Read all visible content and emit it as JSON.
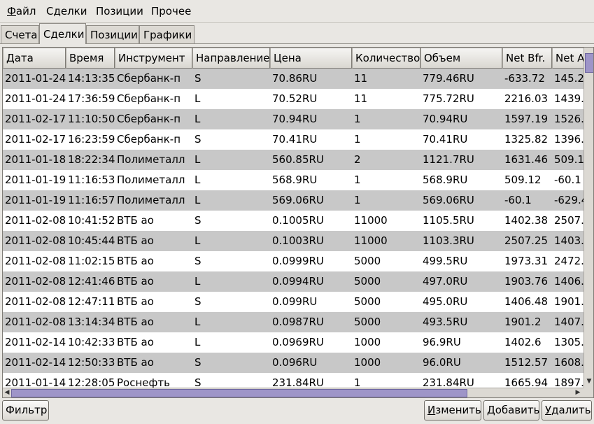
{
  "menubar": {
    "items": [
      {
        "label": "Файл",
        "underline": "Ф",
        "rest": "айл"
      },
      {
        "label": "Сделки"
      },
      {
        "label": "Позиции"
      },
      {
        "label": "Прочее"
      }
    ]
  },
  "tabs": [
    {
      "label": "Счета",
      "active": false
    },
    {
      "label": "Сделки",
      "active": true
    },
    {
      "label": "Позиции",
      "active": false
    },
    {
      "label": "Графики",
      "active": false
    }
  ],
  "table": {
    "columns": [
      "Дата",
      "Время",
      "Инструмент",
      "Направление",
      "Цена",
      "Количество",
      "Объем",
      "Net Bfr.",
      "Net A"
    ],
    "rows": [
      [
        "2011-01-24",
        "14:13:35",
        "Сбербанк-п",
        "S",
        "70.86RU",
        "11",
        "779.46RU",
        "-633.72",
        "145.2"
      ],
      [
        "2011-01-24",
        "17:36:59",
        "Сбербанк-п",
        "L",
        "70.52RU",
        "11",
        "775.72RU",
        "2216.03",
        "1439."
      ],
      [
        "2011-02-17",
        "11:10:50",
        "Сбербанк-п",
        "L",
        "70.94RU",
        "1",
        "70.94RU",
        "1597.19",
        "1526."
      ],
      [
        "2011-02-17",
        "16:23:59",
        "Сбербанк-п",
        "S",
        "70.41RU",
        "1",
        "70.41RU",
        "1325.82",
        "1396."
      ],
      [
        "2011-01-18",
        "18:22:34",
        "Полиметалл",
        "L",
        "560.85RU",
        "2",
        "1121.7RU",
        "1631.46",
        "509.1"
      ],
      [
        "2011-01-19",
        "11:16:53",
        "Полиметалл",
        "L",
        "568.9RU",
        "1",
        "568.9RU",
        "509.12",
        "-60.1"
      ],
      [
        "2011-01-19",
        "11:16:57",
        "Полиметалл",
        "L",
        "569.06RU",
        "1",
        "569.06RU",
        "-60.1",
        "-629.4"
      ],
      [
        "2011-02-08",
        "10:41:52",
        "ВТБ ао",
        "S",
        "0.1005RU",
        "11000",
        "1105.5RU",
        "1402.38",
        "2507."
      ],
      [
        "2011-02-08",
        "10:45:44",
        "ВТБ ао",
        "L",
        "0.1003RU",
        "11000",
        "1103.3RU",
        "2507.25",
        "1403."
      ],
      [
        "2011-02-08",
        "11:02:15",
        "ВТБ ао",
        "S",
        "0.0999RU",
        "5000",
        "499.5RU",
        "1973.31",
        "2472."
      ],
      [
        "2011-02-08",
        "12:41:46",
        "ВТБ ао",
        "L",
        "0.0994RU",
        "5000",
        "497.0RU",
        "1903.76",
        "1406."
      ],
      [
        "2011-02-08",
        "12:47:11",
        "ВТБ ао",
        "S",
        "0.099RU",
        "5000",
        "495.0RU",
        "1406.48",
        "1901."
      ],
      [
        "2011-02-08",
        "13:14:34",
        "ВТБ ао",
        "L",
        "0.0987RU",
        "5000",
        "493.5RU",
        "1901.2",
        "1407."
      ],
      [
        "2011-02-14",
        "10:42:33",
        "ВТБ ао",
        "L",
        "0.0969RU",
        "1000",
        "96.9RU",
        "1402.6",
        "1305."
      ],
      [
        "2011-02-14",
        "12:50:33",
        "ВТБ ао",
        "S",
        "0.096RU",
        "1000",
        "96.0RU",
        "1512.57",
        "1608."
      ],
      [
        "2011-01-14",
        "12:28:05",
        "Роснефть",
        "S",
        "231.84RU",
        "1",
        "231.84RU",
        "1665.94",
        "1897."
      ]
    ]
  },
  "buttons": {
    "filter": {
      "label": "Фильтр"
    },
    "edit": {
      "label": "Изменить",
      "underline": "И",
      "rest": "зменить"
    },
    "add": {
      "label": "Добавить",
      "underline": "Д",
      "rest": "обавить"
    },
    "delete": {
      "label": "Удалить",
      "underline": "У",
      "rest": "далить"
    }
  },
  "colors": {
    "row_odd": "#c8c8c8",
    "row_even": "#ffffff",
    "scroll_thumb": "#9e95c8",
    "window_bg": "#e9e7e3"
  }
}
